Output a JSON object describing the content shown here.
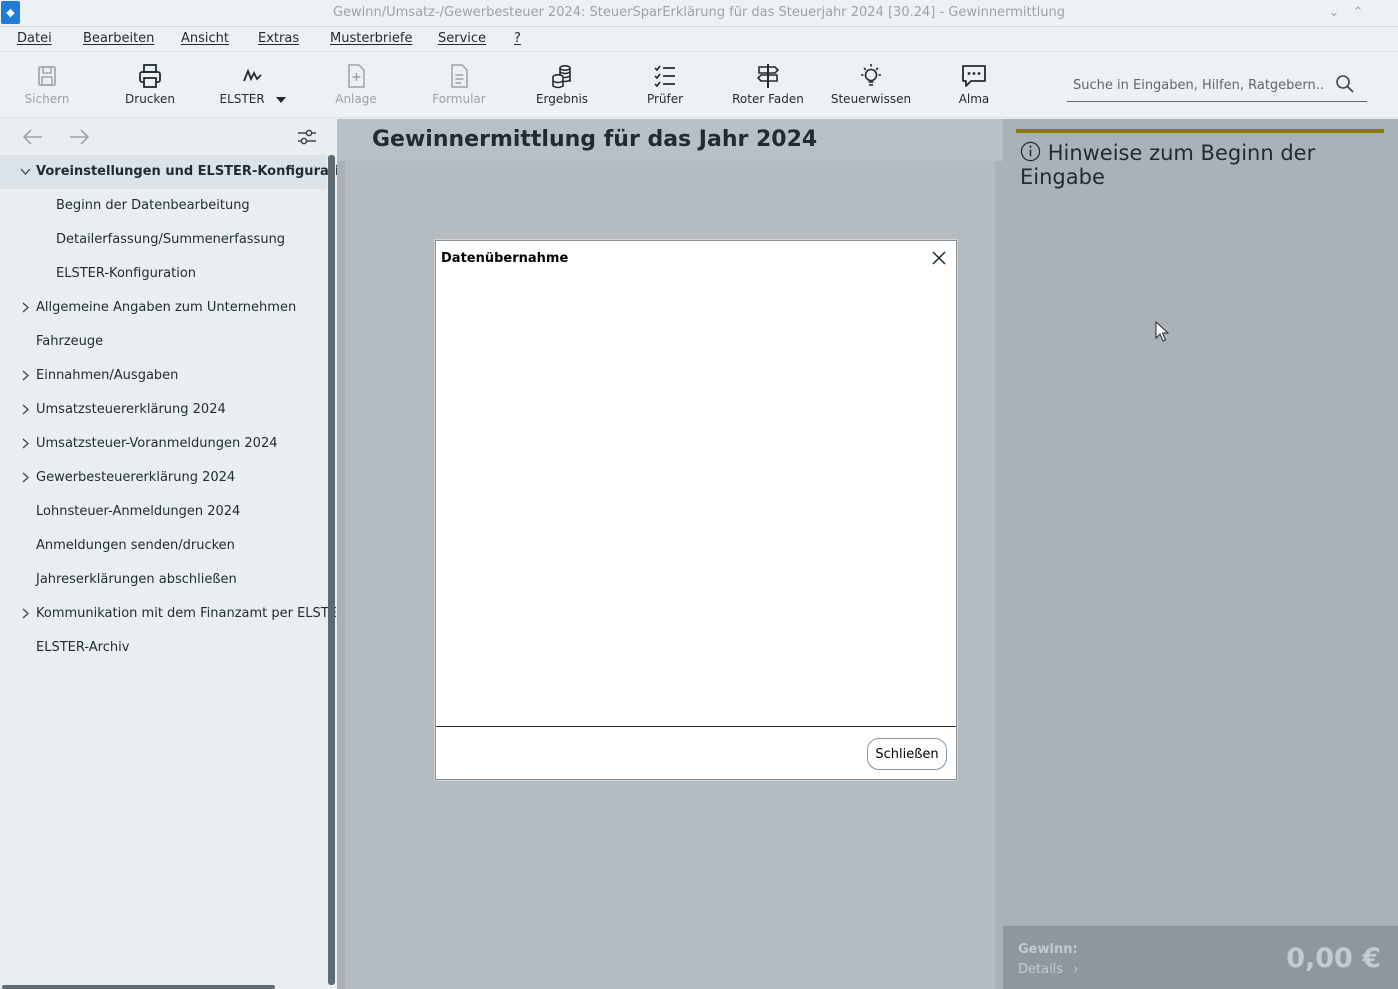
{
  "window": {
    "title": "Gewinn/Umsatz-/Gewerbesteuer 2024: SteuerSparErklärung für das Steuerjahr 2024 [30.24] - Gewinnermittlung"
  },
  "menu": [
    "Datei",
    "Bearbeiten",
    "Ansicht",
    "Extras",
    "Musterbriefe",
    "Service",
    "?"
  ],
  "toolbar": {
    "tools": [
      {
        "label": "Sichern",
        "icon": "save-icon",
        "enabled": false
      },
      {
        "label": "Drucken",
        "icon": "printer-icon",
        "enabled": true
      },
      {
        "label": "ELSTER",
        "icon": "elster-icon",
        "enabled": true
      },
      {
        "label": "Anlage",
        "icon": "add-document-icon",
        "enabled": false
      },
      {
        "label": "Formular",
        "icon": "form-icon",
        "enabled": false
      },
      {
        "label": "Ergebnis",
        "icon": "coins-icon",
        "enabled": true
      },
      {
        "label": "Prüfer",
        "icon": "checklist-icon",
        "enabled": true
      },
      {
        "label": "Roter Faden",
        "icon": "signpost-icon",
        "enabled": true
      },
      {
        "label": "Steuerwissen",
        "icon": "lightbulb-icon",
        "enabled": true
      },
      {
        "label": "Alma",
        "icon": "chat-icon",
        "enabled": true
      }
    ],
    "search_placeholder": "Suche in Eingaben, Hilfen, Ratgebern..."
  },
  "nav": {
    "items": [
      {
        "label": "Voreinstellungen und ELSTER-Konfiguration",
        "level": 0,
        "expandable": true,
        "expanded": true,
        "active": true
      },
      {
        "label": "Beginn der Datenbearbeitung",
        "level": 1
      },
      {
        "label": "Detailerfassung/Summenerfassung",
        "level": 1
      },
      {
        "label": "ELSTER-Konfiguration",
        "level": 1
      },
      {
        "label": "Allgemeine Angaben zum Unternehmen",
        "level": 0,
        "expandable": true
      },
      {
        "label": "Fahrzeuge",
        "level": 0
      },
      {
        "label": "Einnahmen/Ausgaben",
        "level": 0,
        "expandable": true
      },
      {
        "label": "Umsatzsteuererklärung 2024",
        "level": 0,
        "expandable": true
      },
      {
        "label": "Umsatzsteuer-Voranmeldungen 2024",
        "level": 0,
        "expandable": true
      },
      {
        "label": "Gewerbesteuererklärung 2024",
        "level": 0,
        "expandable": true
      },
      {
        "label": "Lohnsteuer-Anmeldungen 2024",
        "level": 0
      },
      {
        "label": "Anmeldungen senden/drucken",
        "level": 0
      },
      {
        "label": "Jahreserklärungen abschließen",
        "level": 0
      },
      {
        "label": "Kommunikation mit dem Finanzamt per ELSTER",
        "level": 0,
        "expandable": true
      },
      {
        "label": "ELSTER-Archiv",
        "level": 0
      }
    ]
  },
  "main": {
    "title": "Gewinnermittlung für das Jahr 2024"
  },
  "right_panel": {
    "title": "Hinweise zum Beginn der Eingabe",
    "footer_label": "Gewinn:",
    "details_label": "Details",
    "amount": "0,00 €"
  },
  "dialog": {
    "title": "Datenübernahme",
    "close_button": "Schließen"
  }
}
